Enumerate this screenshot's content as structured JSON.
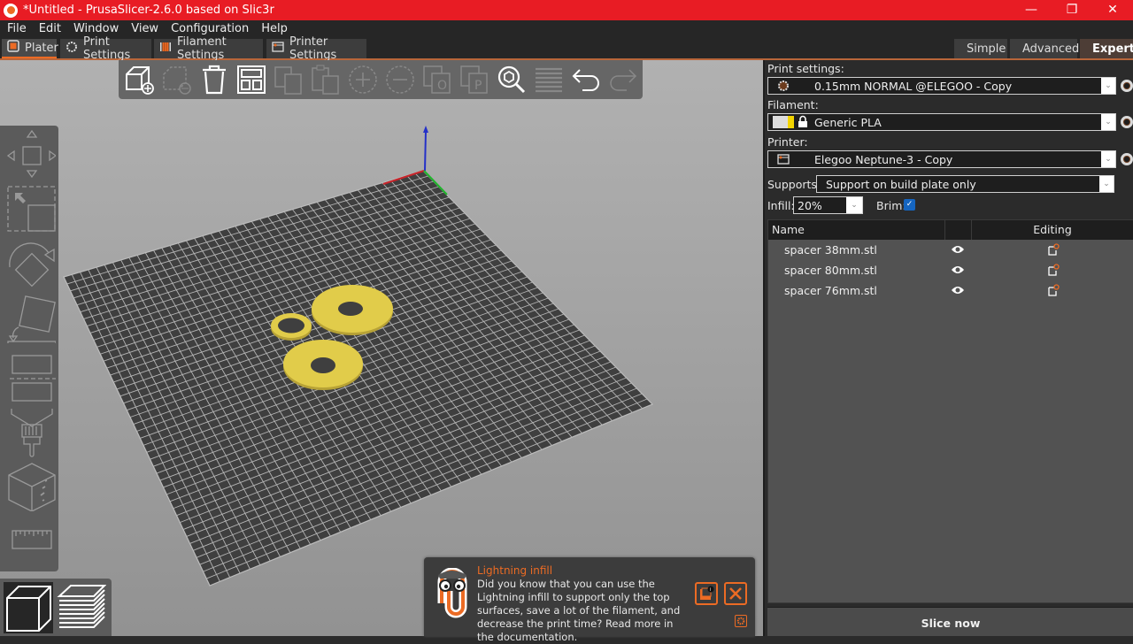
{
  "window": {
    "title": "*Untitled - PrusaSlicer-2.6.0 based on Slic3r",
    "controls": [
      "—",
      "❐",
      "✕"
    ]
  },
  "menu": [
    "File",
    "Edit",
    "Window",
    "View",
    "Configuration",
    "Help"
  ],
  "tabs": [
    {
      "label": "Plater",
      "icon": "plater-icon",
      "active": true
    },
    {
      "label": "Print Settings",
      "icon": "print-settings-icon"
    },
    {
      "label": "Filament Settings",
      "icon": "filament-icon"
    },
    {
      "label": "Printer Settings",
      "icon": "printer-icon"
    }
  ],
  "modes": [
    {
      "label": "Simple",
      "color": "#5ad02a"
    },
    {
      "label": "Advanced",
      "color": "#f2d400"
    },
    {
      "label": "Expert",
      "color": "#e81010",
      "active": true
    }
  ],
  "toolbar": {
    "items": [
      "add-object",
      "delete",
      "delete-all",
      "arrange",
      "copy",
      "paste",
      "add-instance",
      "remove-instance",
      "split-objects",
      "split-parts",
      "search",
      "layer-editing",
      "undo",
      "redo"
    ]
  },
  "left_toolbar": {
    "items": [
      "move",
      "scale",
      "rotate",
      "place-on-face",
      "cut",
      "paint-supports",
      "paint-seam",
      "measure"
    ]
  },
  "view_toggle": {
    "items": [
      "3d-view",
      "preview"
    ],
    "active": "3d-view"
  },
  "scene": {
    "objects": [
      "spacer 38mm.stl",
      "spacer 80mm.stl",
      "spacer 76mm.stl"
    ],
    "object_color": "#e1cc4a",
    "bed_color": "#3f3f3f",
    "grid_color": "#b9b9b9"
  },
  "hint": {
    "title": "Lightning infill",
    "body": "Did you know that you can use the Lightning infill to support only the top surfaces, save a lot of the filament, and decrease the print time? Read more in the documentation."
  },
  "sidebar": {
    "print_settings": {
      "label": "Print settings:",
      "value": "0.15mm NORMAL @ELEGOO - Copy"
    },
    "filament": {
      "label": "Filament:",
      "value": "Generic PLA"
    },
    "printer": {
      "label": "Printer:",
      "value": "Elegoo Neptune-3 - Copy"
    },
    "supports": {
      "label": "Supports:",
      "value": "Support on build plate only"
    },
    "infill": {
      "label": "Infill:",
      "value": "20%"
    },
    "brim": {
      "label": "Brim:",
      "checked": true
    },
    "object_list": {
      "columns": [
        "Name",
        "",
        "Editing"
      ],
      "rows": [
        {
          "name": "spacer 38mm.stl",
          "visible": true
        },
        {
          "name": "spacer 80mm.stl",
          "visible": true
        },
        {
          "name": "spacer 76mm.stl",
          "visible": true
        }
      ]
    },
    "slice_button": "Slice now"
  },
  "accent_color": "#ec6b24"
}
